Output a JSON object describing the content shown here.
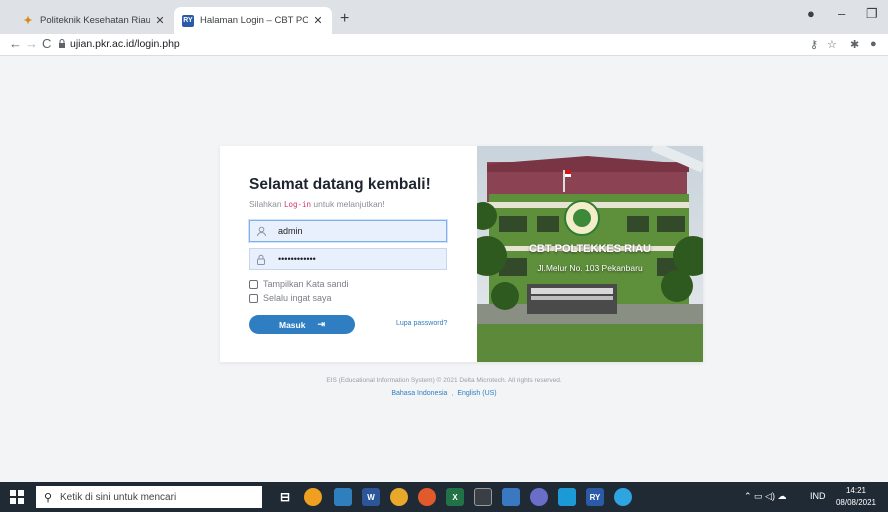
{
  "browser": {
    "tabs": [
      {
        "title": "Politeknik Kesehatan Riau - E-lear",
        "favicon": "pkr-logo-icon",
        "active": false
      },
      {
        "title": "Halaman Login – CBT POLTEKKES",
        "favicon": "ry-logo-icon",
        "active": true
      }
    ],
    "url": "ujian.pkr.ac.id/login.php"
  },
  "login": {
    "heading": "Selamat datang kembali!",
    "subtitle_pre": "Silahkan ",
    "subtitle_code": "Log-in",
    "subtitle_post": " untuk melanjutkan!",
    "username_value": "admin",
    "password_mask": "••••••••••••",
    "show_password_label": "Tampilkan Kata sandi",
    "remember_label": "Selalu ingat saya",
    "submit_label": "Masuk",
    "forgot_label": "Lupa password?"
  },
  "photo": {
    "title": "CBT POLTEKKES RIAU",
    "address": "Jl.Melur No. 103 Pekanbaru"
  },
  "footer": {
    "copyright": "EIS (Educational Information System) © 2021 Delta Microtech. All rights reserved.",
    "lang_id": "Bahasa Indonesia",
    "lang_sep": ",",
    "lang_en": "English (US)"
  },
  "taskbar": {
    "search_placeholder": "Ketik di sini untuk mencari",
    "lang": "IND",
    "time": "14:21",
    "date": "08/08/2021"
  },
  "colors": {
    "accent": "#2f7ec2",
    "taskbar": "#1f2a35",
    "input_bg": "#e8f0fe"
  }
}
